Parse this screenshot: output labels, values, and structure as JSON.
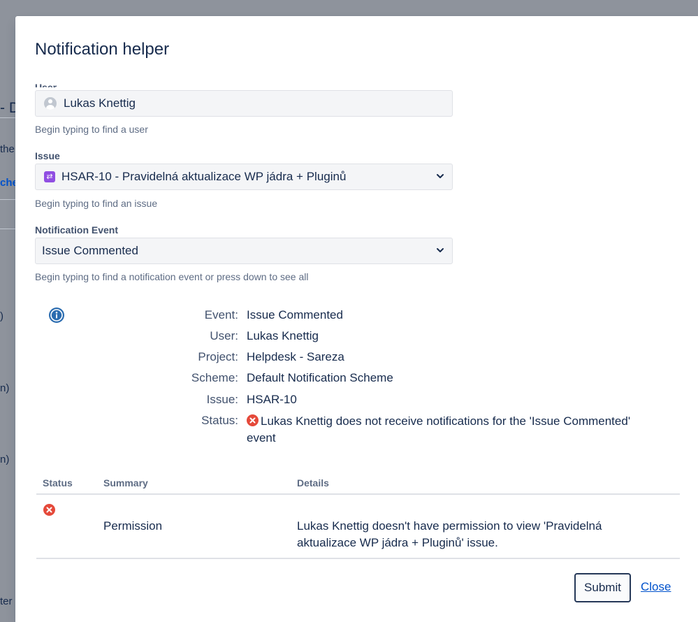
{
  "background": {
    "fragments": [
      "- D",
      "the",
      "che",
      ")",
      "n)",
      "n)",
      "ter"
    ]
  },
  "dialog": {
    "title": "Notification helper",
    "user_field": {
      "label": "User",
      "value": "Lukas Knettig",
      "help": "Begin typing to find a user"
    },
    "issue_field": {
      "label": "Issue",
      "value": "HSAR-10 - Pravidelná aktualizace WP jádra + Pluginů",
      "help": "Begin typing to find an issue"
    },
    "event_field": {
      "label": "Notification Event",
      "value": "Issue Commented",
      "help": "Begin typing to find a notification event or press down to see all"
    },
    "details": {
      "event_label": "Event:",
      "event_value": "Issue Commented",
      "user_label": "User:",
      "user_value": "Lukas Knettig",
      "project_label": "Project:",
      "project_value": "Helpdesk - Sareza",
      "scheme_label": "Scheme:",
      "scheme_value": "Default Notification Scheme",
      "issue_label": "Issue:",
      "issue_value": "HSAR-10",
      "status_label": "Status:",
      "status_value": "Lukas Knettig does not receive notifications for the 'Issue Commented' event"
    },
    "table": {
      "headers": [
        "Status",
        "Summary",
        "Details"
      ],
      "rows": [
        {
          "summary": "Permission",
          "details": "Lukas Knettig doesn't have permission to view 'Pravidelná aktualizace WP jádra + Pluginů' issue."
        }
      ]
    },
    "buttons": {
      "submit": "Submit",
      "close": "Close"
    },
    "colors": {
      "link": "#0052cc",
      "error": "#de350b",
      "info": "#0065ff",
      "issue_type": "#904ee2"
    }
  }
}
